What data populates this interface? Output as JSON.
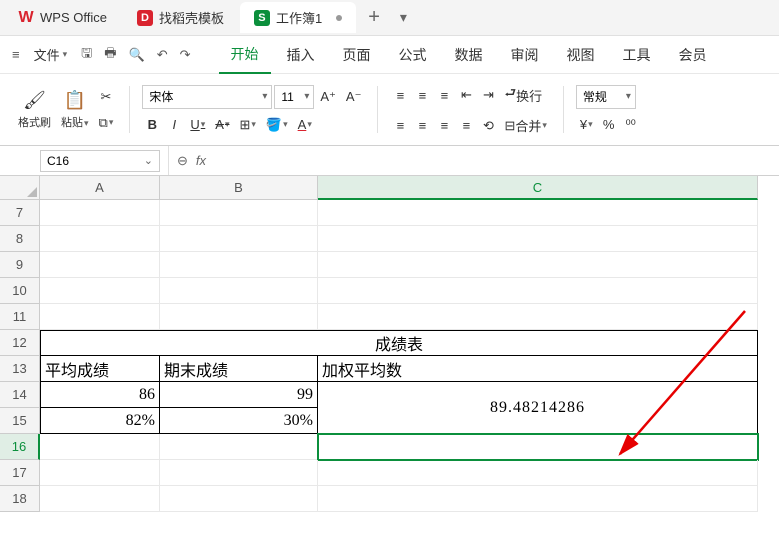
{
  "titlebar": {
    "app_name": "WPS Office",
    "tabs": [
      {
        "label": "找稻壳模板"
      },
      {
        "label": "工作簿1"
      }
    ]
  },
  "menubar": {
    "file": "文件",
    "tabs": [
      "开始",
      "插入",
      "页面",
      "公式",
      "数据",
      "审阅",
      "视图",
      "工具",
      "会员"
    ]
  },
  "ribbon": {
    "format_painter": "格式刷",
    "paste": "粘贴",
    "font_name": "宋体",
    "font_size": "11",
    "wrap": "换行",
    "merge": "合并",
    "general": "常规"
  },
  "refbar": {
    "cell": "C16"
  },
  "grid": {
    "col_widths": {
      "A": 120,
      "B": 158,
      "C": 440
    },
    "columns": [
      "A",
      "B",
      "C"
    ],
    "active_col": "C",
    "row_start": 7,
    "row_end": 18,
    "active_row": 16
  },
  "chart_data": {
    "type": "table",
    "title": "成绩表",
    "headers": [
      "平均成绩",
      "期末成绩",
      "加权平均数"
    ],
    "rows": [
      {
        "A": "86",
        "B": "99",
        "C_merged": "89.48214286"
      },
      {
        "A": "82%",
        "B": "30%"
      }
    ]
  }
}
